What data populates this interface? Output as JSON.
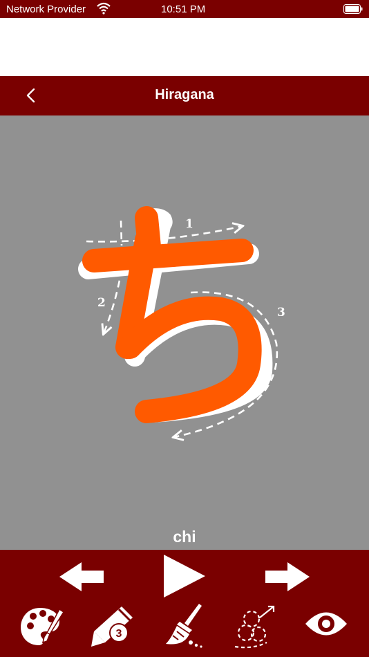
{
  "status_bar": {
    "carrier": "Network Provider",
    "time": "10:51 PM"
  },
  "nav": {
    "title": "Hiragana",
    "back_icon": "chevron-left-icon"
  },
  "character": {
    "glyph": "ち",
    "romaji": "chi",
    "stroke_color": "#ff5a00",
    "stroke_numbers": [
      "1",
      "2",
      "3"
    ]
  },
  "colors": {
    "brand": "#7a0000",
    "canvas": "#919191"
  },
  "toolbar": {
    "row1": [
      "arrow-left-icon",
      "play-icon",
      "arrow-right-icon"
    ],
    "row2": [
      "palette-icon",
      "pencil-icon",
      "broom-icon",
      "trace-path-icon",
      "eye-icon"
    ],
    "pencil_badge": "3"
  }
}
